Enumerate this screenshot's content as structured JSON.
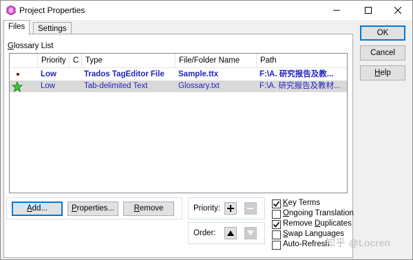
{
  "window": {
    "title": "Project Properties",
    "minimize": "—",
    "maximize": "☐",
    "close": "✕"
  },
  "tabs": [
    {
      "label": "Files",
      "active": true
    },
    {
      "label": "Settings",
      "active": false
    }
  ],
  "glossary": {
    "group_label": "Glossary List",
    "columns": [
      "Priority",
      "C",
      "Type",
      "File/Folder Name",
      "Path"
    ],
    "rows": [
      {
        "icon": "dot-icon",
        "priority": "Low",
        "c": "",
        "type": "Trados TagEditor File",
        "name": "Sample.ttx",
        "path": "F:\\A. 研究报告及教...",
        "bold": true,
        "selected": false
      },
      {
        "icon": "green-star-icon",
        "priority": "Low",
        "c": "",
        "type": "Tab-delimited Text",
        "name": "Glossary.txt",
        "path": "F:\\A. 研究报告及教材...",
        "bold": false,
        "selected": true
      }
    ]
  },
  "buttons": {
    "add": "Add...",
    "properties": "Properties...",
    "remove": "Remove"
  },
  "priority_label": "Priority:",
  "order_label": "Order:",
  "checkboxes": [
    {
      "label": "Key Terms",
      "checked": true
    },
    {
      "label": "Ongoing Translation",
      "checked": false
    },
    {
      "label": "Remove Duplicates",
      "checked": true
    },
    {
      "label": "Swap Languages",
      "checked": false
    },
    {
      "label": "Auto-Refresh",
      "checked": false
    }
  ],
  "side_buttons": {
    "ok": "OK",
    "cancel": "Cancel",
    "help": "Help"
  },
  "watermark": "知乎 @Locren"
}
